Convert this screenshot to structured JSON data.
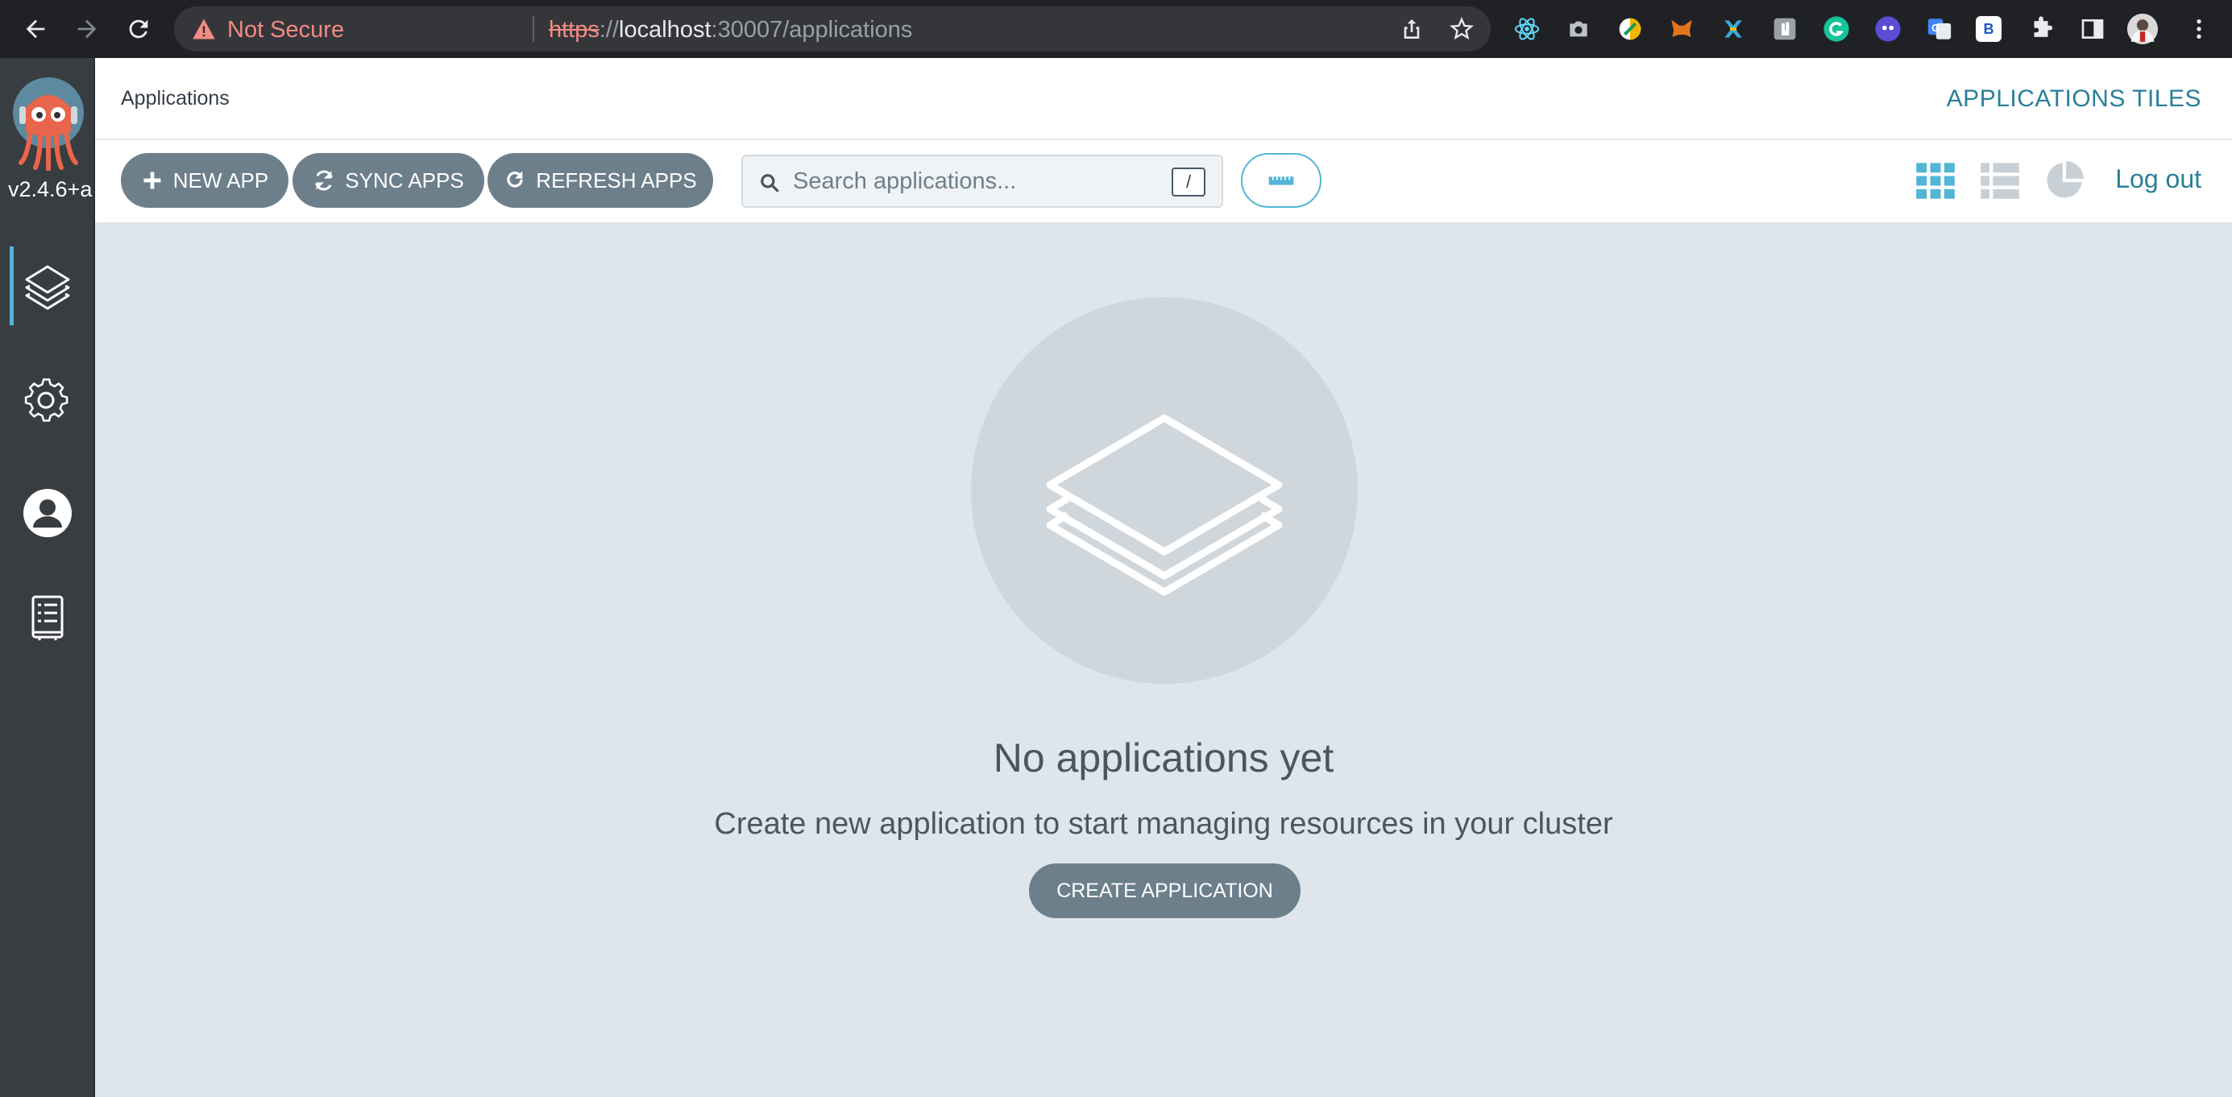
{
  "browser": {
    "security_label": "Not Secure",
    "url_protocol": "https",
    "url_sep": "://",
    "url_host": "localhost",
    "url_path": ":30007/applications",
    "extension_badge_b": "B"
  },
  "sidebar": {
    "version": "v2.4.6+a",
    "items": [
      {
        "name": "applications",
        "icon": "layers-icon"
      },
      {
        "name": "settings",
        "icon": "gear-icon"
      },
      {
        "name": "user-info",
        "icon": "user-icon"
      },
      {
        "name": "documentation",
        "icon": "book-icon"
      }
    ]
  },
  "header": {
    "title": "Applications",
    "view_title": "APPLICATIONS TILES"
  },
  "toolbar": {
    "new_app": "NEW APP",
    "sync_apps": "SYNC APPS",
    "refresh_apps": "REFRESH APPS",
    "search_placeholder": "Search applications...",
    "search_shortcut": "/",
    "logout": "Log out"
  },
  "empty_state": {
    "title": "No applications yet",
    "subtitle": "Create new application to start managing resources in your cluster",
    "create_button": "CREATE APPLICATION"
  },
  "colors": {
    "accent": "#2a7f9a",
    "button": "#6d7f8b",
    "sidebar": "#383d42",
    "background": "#dee6eb"
  }
}
